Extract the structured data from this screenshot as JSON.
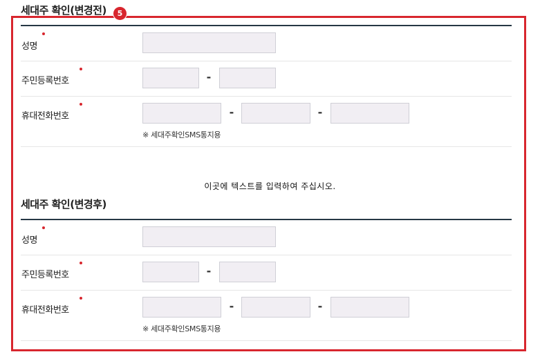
{
  "marker": "5",
  "before": {
    "title": "세대주 확인(변경전)",
    "name_label": "성명",
    "rrn_label": "주민등록번호",
    "phone_label": "휴대전화번호",
    "dash": "-",
    "sms_notice": "※ 세대주확인SMS통지용",
    "name_value": "",
    "rrn_front": "",
    "rrn_back": "",
    "phone_1": "",
    "phone_2": "",
    "phone_3": ""
  },
  "center_text": "이곳에 텍스트를 입력하여 주십시오.",
  "after": {
    "title": "세대주 확인(변경후)",
    "name_label": "성명",
    "rrn_label": "주민등록번호",
    "phone_label": "휴대전화번호",
    "dash": "-",
    "sms_notice": "※ 세대주확인SMS통지용",
    "name_value": "",
    "rrn_front": "",
    "rrn_back": "",
    "phone_1": "",
    "phone_2": "",
    "phone_3": ""
  },
  "colors": {
    "highlight_border": "#d8262e",
    "required_dot": "#d8262e",
    "input_background": "#f1eef3",
    "section_rule": "#253744"
  }
}
